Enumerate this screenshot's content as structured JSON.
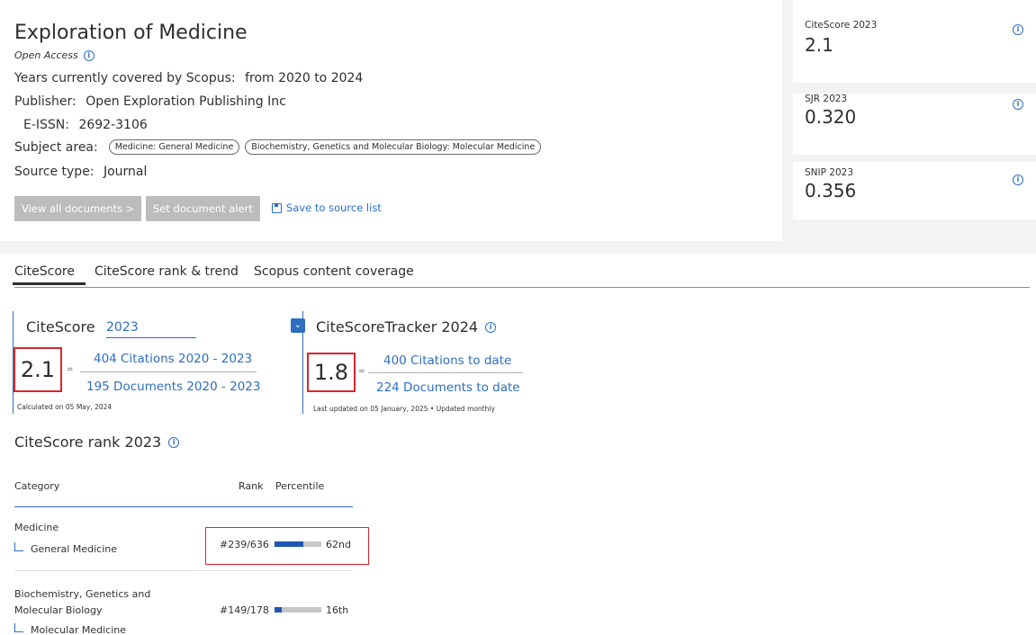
{
  "journal": {
    "title": "Exploration of Medicine",
    "open_access": "Open Access",
    "years_label": "Years currently covered by Scopus:",
    "years_value": "from 2020 to 2024",
    "publisher_label": "Publisher:",
    "publisher_value": "Open Exploration Publishing Inc",
    "eissn_label": "E-ISSN:",
    "eissn_value": "2692-3106",
    "subject_label": "Subject area:",
    "subjects": [
      "Medicine: General Medicine",
      "Biochemistry, Genetics and Molecular Biology: Molecular Medicine"
    ],
    "source_type_label": "Source type:",
    "source_type_value": "Journal"
  },
  "actions": {
    "view_all": "View all documents >",
    "set_alert": "Set document alert",
    "save_source": "Save to source list"
  },
  "metrics": [
    {
      "label": "CiteScore 2023",
      "value": "2.1"
    },
    {
      "label": "SJR 2023",
      "value": "0.320"
    },
    {
      "label": "SNIP 2023",
      "value": "0.356"
    }
  ],
  "tabs": [
    "CiteScore",
    "CiteScore rank & trend",
    "Scopus content coverage"
  ],
  "citescore": {
    "title": "CiteScore",
    "year": "2023",
    "value": "2.1",
    "numerator": "404 Citations 2020 - 2023",
    "denominator": "195 Documents 2020 - 2023",
    "calculated": "Calculated on 05 May, 2024"
  },
  "tracker": {
    "title": "CiteScoreTracker 2024",
    "value": "1.8",
    "numerator": "400 Citations to date",
    "denominator": "224 Documents to date",
    "updated": "Last updated on 05 January, 2025 • Updated monthly"
  },
  "rank": {
    "title": "CiteScore rank 2023",
    "headers": {
      "category": "Category",
      "rank": "Rank",
      "percentile": "Percentile"
    },
    "rows": [
      {
        "main": "Medicine",
        "main2": "",
        "sub": "General Medicine",
        "rank": "#239/636",
        "percentile": "62nd",
        "percentile_value": 62
      },
      {
        "main": "Biochemistry, Genetics and",
        "main2": "Molecular Biology",
        "sub": "Molecular Medicine",
        "rank": "#149/178",
        "percentile": "16th",
        "percentile_value": 16
      }
    ]
  },
  "colors": {
    "accent": "#2e6ec0",
    "highlight": "#d9262b",
    "bar": "#1e55b4"
  }
}
